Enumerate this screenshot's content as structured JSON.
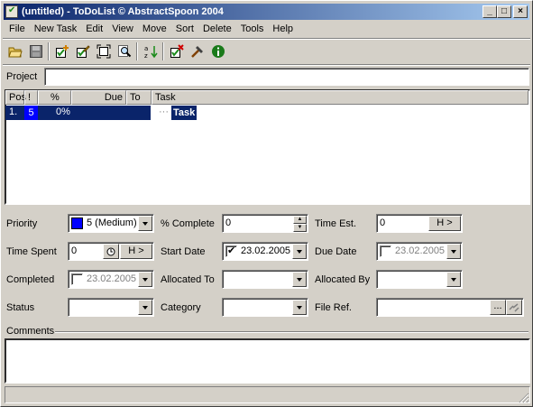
{
  "window": {
    "title": "(untitled) - ToDoList © AbstractSpoon 2004",
    "controls": [
      "minimize",
      "maximize",
      "close"
    ]
  },
  "menu": [
    "File",
    "New Task",
    "Edit",
    "View",
    "Move",
    "Sort",
    "Delete",
    "Tools",
    "Help"
  ],
  "toolbar": {
    "icons": [
      "open-folder-icon",
      "save-icon",
      "new-task-icon",
      "edit-task-icon",
      "maximize-icon",
      "find-icon",
      "sort-icon",
      "delete-task-icon",
      "tools-icon",
      "info-icon"
    ]
  },
  "project": {
    "label": "Project",
    "value": ""
  },
  "task_list": {
    "columns": [
      "Pos",
      "!",
      "%",
      "Due",
      "To",
      "Task"
    ],
    "rows": [
      {
        "pos": "1.",
        "priority": "5",
        "percent": "0%",
        "due": "",
        "to": "",
        "task": "Task"
      }
    ]
  },
  "fields": {
    "priority": {
      "label": "Priority",
      "value": "5 (Medium)",
      "color": "#0000ff"
    },
    "percent_complete": {
      "label": "% Complete",
      "value": "0"
    },
    "time_est": {
      "label": "Time Est.",
      "value": "0",
      "units": "H >"
    },
    "time_spent": {
      "label": "Time Spent",
      "value": "0",
      "units": "H >"
    },
    "start_date": {
      "label": "Start Date",
      "value": "23.02.2005",
      "checked": true
    },
    "due_date": {
      "label": "Due Date",
      "value": "23.02.2005",
      "checked": false
    },
    "completed": {
      "label": "Completed",
      "value": "23.02.2005",
      "checked": false
    },
    "allocated_to": {
      "label": "Allocated To",
      "value": ""
    },
    "allocated_by": {
      "label": "Allocated By",
      "value": ""
    },
    "status": {
      "label": "Status",
      "value": ""
    },
    "category": {
      "label": "Category",
      "value": ""
    },
    "file_ref": {
      "label": "File Ref.",
      "value": "",
      "browse": "..."
    }
  },
  "comments": {
    "label": "Comments",
    "value": ""
  },
  "colors": {
    "selection": "#0a246a",
    "titlebar_start": "#0a246a",
    "titlebar_end": "#a6caf0",
    "face": "#d4d0c8"
  }
}
